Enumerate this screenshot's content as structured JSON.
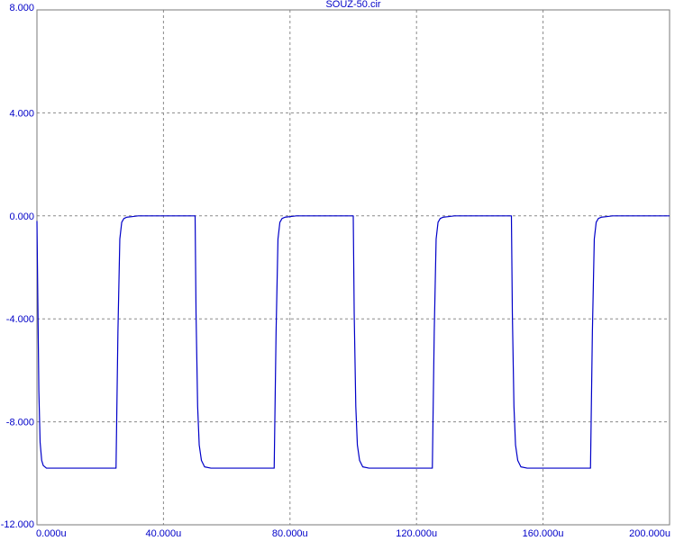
{
  "window": {
    "title": "SOUZ-50.cir"
  },
  "colors": {
    "text": "#0000c8",
    "trace": "#0000c8",
    "grid": "#8a8a8a",
    "frame": "#7a7a7a",
    "background": "#ffffff"
  },
  "chart_data": {
    "type": "line",
    "title": "SOUZ-50.cir",
    "xlabel": "",
    "ylabel": "",
    "xlim": [
      0,
      200
    ],
    "ylim": [
      -12,
      8
    ],
    "grid": true,
    "x_ticks": [
      0,
      40,
      80,
      120,
      160,
      200
    ],
    "x_tick_labels": [
      "0.000u",
      "40.000u",
      "80.000u",
      "120.000u",
      "160.000u",
      "200.000u"
    ],
    "y_ticks": [
      8,
      4,
      0,
      -4,
      -8,
      -12
    ],
    "y_tick_labels": [
      "8.000",
      "4.000",
      "0.000",
      "-4.000",
      "-8.000",
      "-12.000"
    ],
    "series": [
      {
        "x": [
          0,
          0.3,
          0.6,
          1,
          1.5,
          2,
          3,
          5,
          25,
          25.6,
          26.2,
          26.8,
          27.5,
          28.5,
          30,
          32,
          50,
          50.3,
          50.8,
          51.3,
          52,
          53,
          55,
          75,
          75.6,
          76.2,
          76.8,
          77.5,
          78.5,
          80,
          82,
          100,
          100.3,
          100.8,
          101.3,
          102,
          103,
          105,
          125,
          125.6,
          126.2,
          126.8,
          127.5,
          128.5,
          130,
          132,
          150,
          150.3,
          150.8,
          151.3,
          152,
          153,
          155,
          175,
          175.6,
          176.2,
          176.8,
          177.5,
          178.5,
          180,
          182,
          200
        ],
        "y": [
          -0.2,
          -3.5,
          -6.8,
          -8.8,
          -9.5,
          -9.7,
          -9.8,
          -9.8,
          -9.8,
          -4.5,
          -0.9,
          -0.25,
          -0.1,
          -0.05,
          -0.03,
          0,
          0,
          -3.8,
          -7.4,
          -8.9,
          -9.5,
          -9.75,
          -9.8,
          -9.8,
          -4.5,
          -0.9,
          -0.25,
          -0.1,
          -0.05,
          -0.03,
          0,
          0,
          -3.8,
          -7.4,
          -8.9,
          -9.5,
          -9.75,
          -9.8,
          -9.8,
          -4.5,
          -0.9,
          -0.25,
          -0.1,
          -0.05,
          -0.03,
          0,
          0,
          -3.8,
          -7.4,
          -8.9,
          -9.5,
          -9.75,
          -9.8,
          -9.8,
          -4.5,
          -0.9,
          -0.25,
          -0.1,
          -0.05,
          -0.03,
          0,
          0
        ]
      }
    ]
  }
}
